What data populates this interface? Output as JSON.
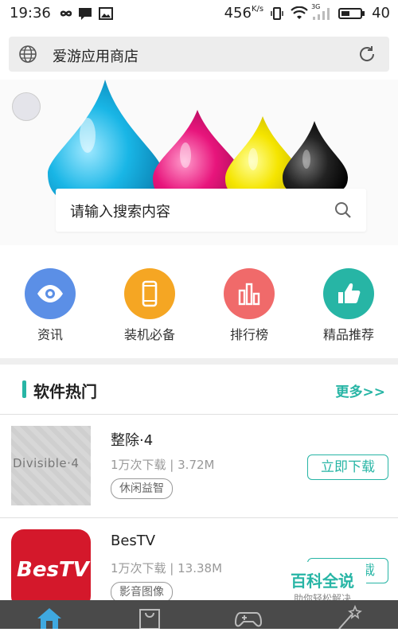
{
  "status_bar": {
    "time": "19:36",
    "speed": "456",
    "speed_unit": "K/s",
    "network": "3G",
    "battery": "40"
  },
  "url_bar": {
    "title": "爱游应用商店"
  },
  "search": {
    "placeholder": "请输入搜索内容"
  },
  "categories": [
    {
      "label": "资讯",
      "icon": "eye-icon",
      "color": "#5b8fe6"
    },
    {
      "label": "装机必备",
      "icon": "phone-icon",
      "color": "#f5a623"
    },
    {
      "label": "排行榜",
      "icon": "bar-chart-icon",
      "color": "#f06a6a"
    },
    {
      "label": "精品推荐",
      "icon": "thumbs-up-icon",
      "color": "#27b5a5"
    }
  ],
  "section": {
    "title": "软件热门",
    "more": "更多>>"
  },
  "apps": [
    {
      "name": "整除·4",
      "thumb_text": "Divisible·4",
      "meta": "1万次下载 | 3.72M",
      "tag": "休闲益智",
      "download": "立即下载"
    },
    {
      "name": "BesTV",
      "thumb_text": "BesTV",
      "meta": "1万次下载 | 13.38M",
      "tag": "影音图像",
      "download": "立即下载"
    }
  ],
  "watermark": {
    "title": "百科全说",
    "subtitle": "助你轻松解决"
  },
  "bottom_nav": [
    "home-icon",
    "bag-icon",
    "gamepad-icon",
    "magic-wand-icon"
  ]
}
